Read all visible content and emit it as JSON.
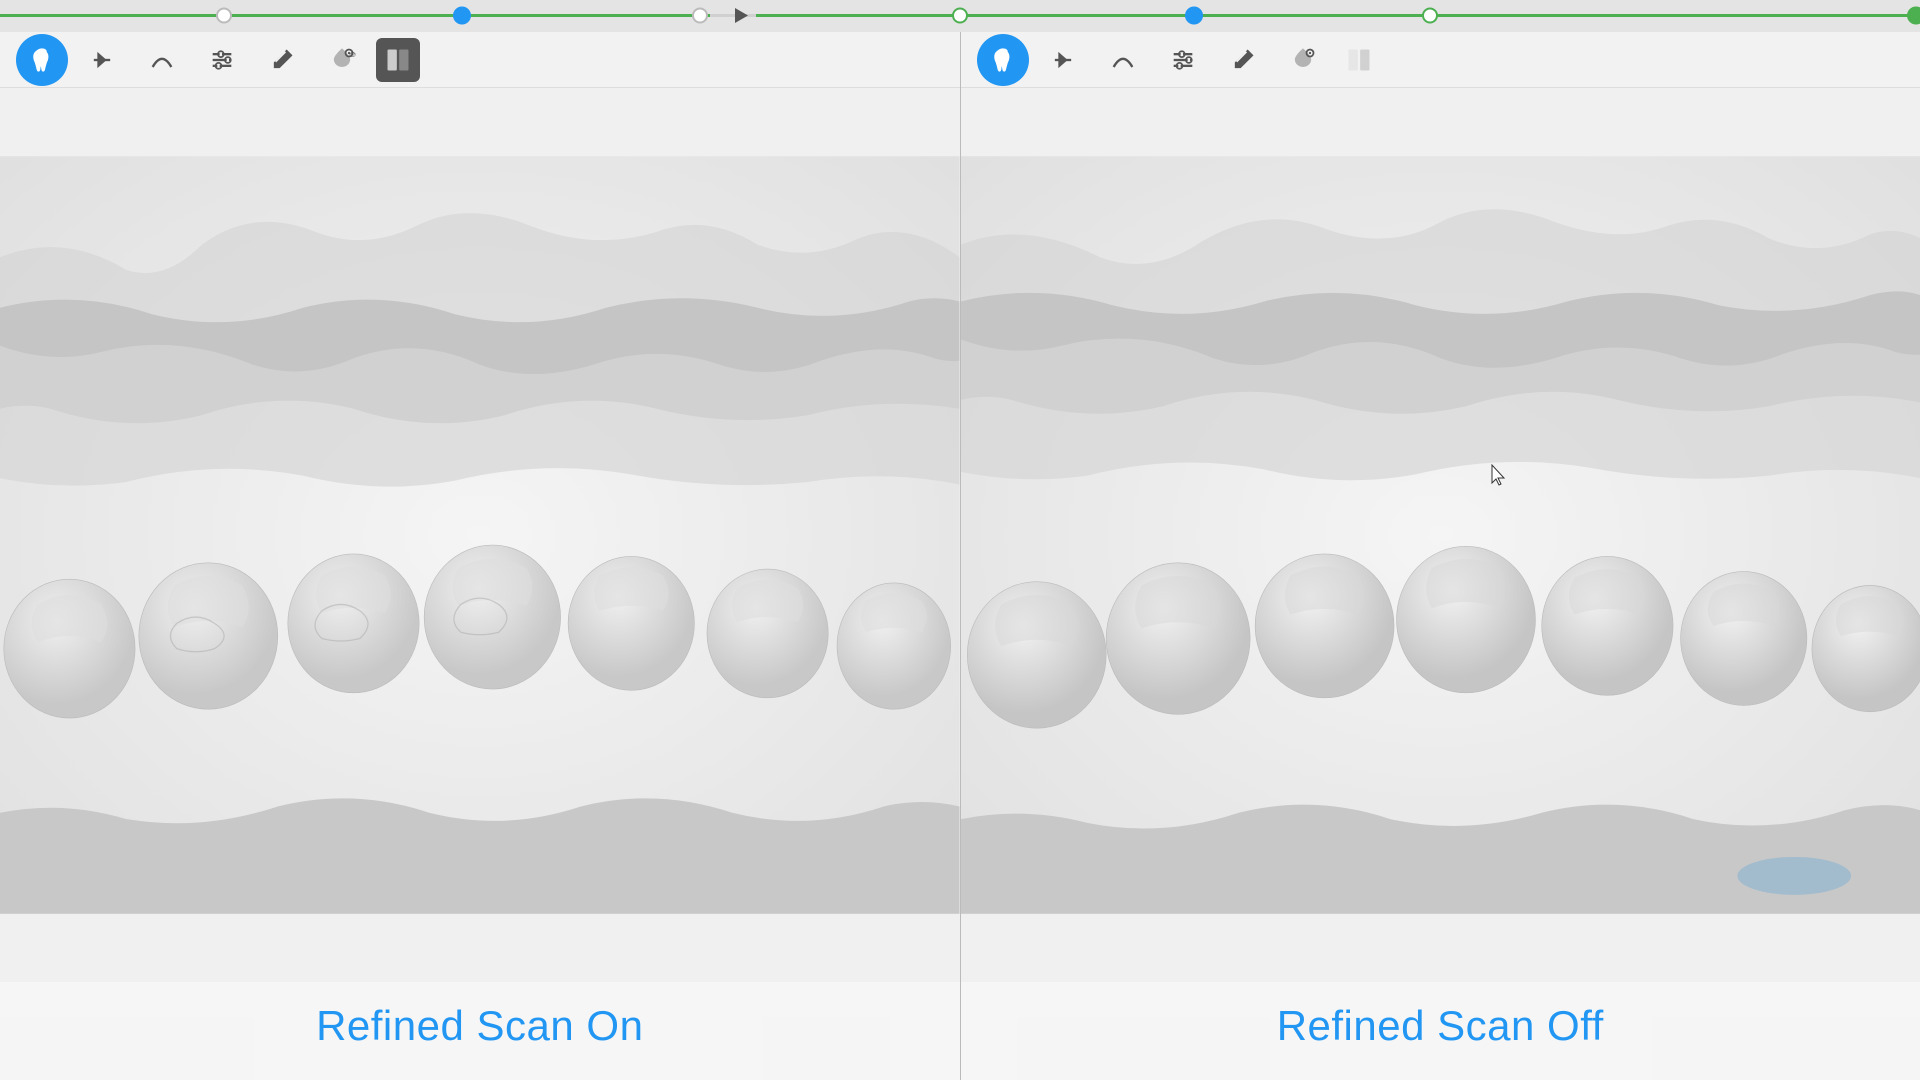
{
  "progress": {
    "left_dots": [
      {
        "pos": 15,
        "type": "white"
      },
      {
        "pos": 32,
        "type": "blue"
      },
      {
        "pos": 49,
        "type": "white"
      },
      {
        "pos": 51,
        "type": "arrow"
      }
    ],
    "right_dots": [
      {
        "pos": 63,
        "type": "white"
      },
      {
        "pos": 80,
        "type": "blue"
      },
      {
        "pos": 98,
        "type": "green"
      }
    ],
    "left_green_end": 48,
    "right_green_start": 53
  },
  "left_panel": {
    "label": "Refined Scan On",
    "toolbar": {
      "tooth_btn_active": true,
      "buttons": [
        "tooth",
        "arrow-right",
        "arch",
        "adjust",
        "eraser",
        "bucket-eye",
        "compare"
      ]
    }
  },
  "right_panel": {
    "label": "Refined Scan Off",
    "toolbar": {
      "tooth_btn_active": true,
      "buttons": [
        "tooth",
        "arrow-right",
        "arch",
        "adjust",
        "eraser",
        "bucket-eye",
        "compare"
      ]
    }
  },
  "colors": {
    "blue": "#2196F3",
    "green": "#4caf50",
    "label_blue": "#2196F3",
    "bg": "#f0f0f0",
    "toolbar_bg": "#f5f5f5"
  }
}
